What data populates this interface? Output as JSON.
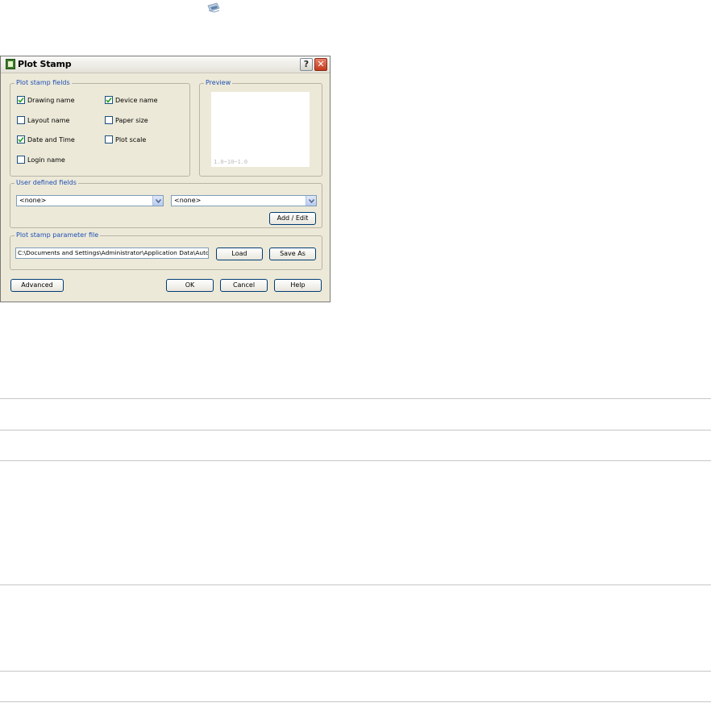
{
  "dialog": {
    "title": "Plot Stamp",
    "help_label": "?",
    "close_label": "✕",
    "icons": {
      "top": "plot-stamp-toolbar-icon",
      "app": "plot-stamp-icon"
    },
    "plot_stamp_fields": {
      "legend": "Plot stamp fields",
      "drawing_name": {
        "label": "Drawing name",
        "checked": true
      },
      "device_name": {
        "label": "Device name",
        "checked": true
      },
      "layout_name": {
        "label": "Layout name",
        "checked": false
      },
      "paper_size": {
        "label": "Paper size",
        "checked": false
      },
      "date_and_time": {
        "label": "Date and Time",
        "checked": true
      },
      "plot_scale": {
        "label": "Plot scale",
        "checked": false
      },
      "login_name": {
        "label": "Login name",
        "checked": false
      }
    },
    "preview": {
      "legend": "Preview",
      "stamp_text": "1.0~10~1.0"
    },
    "user_defined_fields": {
      "legend": "User defined fields",
      "combo1_value": "<none>",
      "combo2_value": "<none>",
      "add_edit_label": "Add / Edit"
    },
    "parameter_file": {
      "legend": "Plot stamp parameter file",
      "path_value": "C:\\Documents and Settings\\Administrator\\Application Data\\Autodesk",
      "load_label": "Load",
      "save_as_label": "Save As"
    },
    "footer": {
      "advanced_label": "Advanced",
      "ok_label": "OK",
      "cancel_label": "Cancel",
      "help_label": "Help"
    }
  }
}
